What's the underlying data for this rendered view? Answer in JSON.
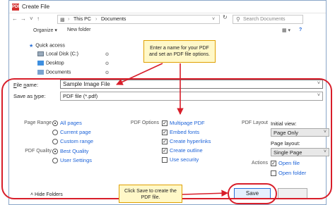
{
  "window": {
    "title": "Create File",
    "app_icon": "pdf"
  },
  "address": {
    "path": [
      "This PC",
      "Documents"
    ],
    "search_placeholder": "Search Documents"
  },
  "toolbar": {
    "organize": "Organize",
    "new_folder": "New folder"
  },
  "nav": {
    "items": [
      {
        "label": "Quick access",
        "icon": "star-icon"
      },
      {
        "label": "Local Disk (C:)",
        "icon": "disk-icon"
      },
      {
        "label": "Desktop",
        "icon": "folder-icon"
      },
      {
        "label": "Documents",
        "icon": "folder-icon"
      }
    ]
  },
  "callouts": {
    "top": "Enter a name for your PDF\nand set an PDF file options.",
    "bottom": "Click Save to create the\nPDF file."
  },
  "form": {
    "filename_label": "File name:",
    "filename_value": "Sample Image File",
    "savetype_label": "Save as type:",
    "savetype_value": "PDF file (*.pdf)"
  },
  "options": {
    "page_range_label": "Page Range",
    "page_range": [
      {
        "label": "All pages",
        "checked": true
      },
      {
        "label": "Current page",
        "checked": false
      },
      {
        "label": "Custom range",
        "checked": false
      }
    ],
    "pdf_quality_label": "PDF Quality",
    "pdf_quality": [
      {
        "label": "Best Quality",
        "checked": true
      },
      {
        "label": "User Settings",
        "checked": false
      }
    ],
    "pdf_options_label": "PDF Options",
    "pdf_options": [
      {
        "label": "Multipage PDF",
        "checked": true
      },
      {
        "label": "Embed fonts",
        "checked": true
      },
      {
        "label": "Create hyperlinks",
        "checked": true
      },
      {
        "label": "Create outline",
        "checked": true
      },
      {
        "label": "Use security",
        "checked": false
      }
    ],
    "pdf_layout_label": "PDF Layout",
    "initial_view_label": "Initial view:",
    "initial_view_value": "Page Only",
    "page_layout_label": "Page layout:",
    "page_layout_value": "Single Page",
    "actions_label": "Actions",
    "actions": [
      {
        "label": "Open file",
        "checked": true
      },
      {
        "label": "Open folder",
        "checked": false
      }
    ]
  },
  "footer": {
    "hide_folders": "Hide Folders",
    "save": "Save"
  },
  "colors": {
    "annotation": "#d81e2a",
    "callout_bg": "#fff8c8",
    "link": "#1d63d8"
  }
}
